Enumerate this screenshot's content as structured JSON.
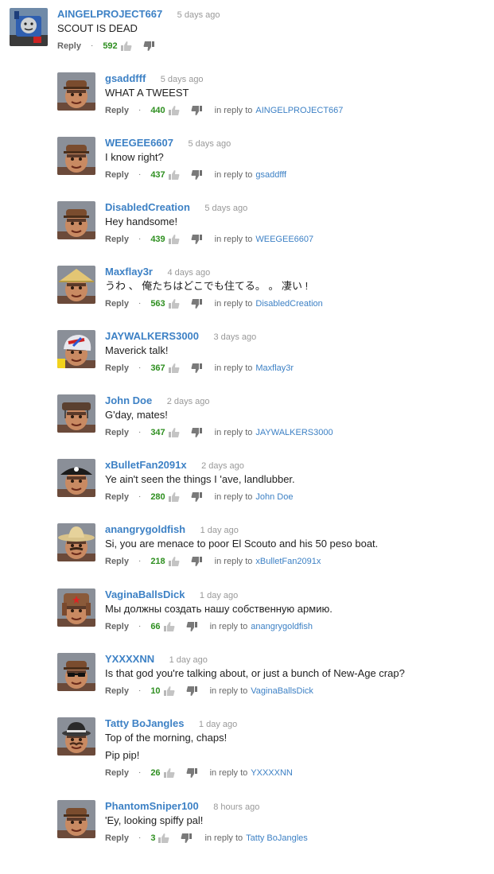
{
  "colors": {
    "author": "#3d81c5",
    "likes": "#2e8f20",
    "timestamp": "#999999",
    "meta": "#666666"
  },
  "labels": {
    "reply": "Reply",
    "in_reply_to": "in reply to"
  },
  "comments": [
    {
      "author": "AINGELPROJECT667",
      "time": "5 days ago",
      "text": [
        "SCOUT IS DEAD"
      ],
      "likes": "592",
      "in_reply_to": "",
      "avatar_icon": "thomas-engine-avatar-icon"
    },
    {
      "author": "gsaddfff",
      "time": "5 days ago",
      "text": [
        "WHAT A TWEEST"
      ],
      "likes": "440",
      "in_reply_to": "AINGELPROJECT667",
      "avatar_icon": "scout-avatar-icon"
    },
    {
      "author": "WEEGEE6607",
      "time": "5 days ago",
      "text": [
        "I know right?"
      ],
      "likes": "437",
      "in_reply_to": "gsaddfff",
      "avatar_icon": "scout-avatar-icon"
    },
    {
      "author": "DisabledCreation",
      "time": "5 days ago",
      "text": [
        "Hey handsome!"
      ],
      "likes": "439",
      "in_reply_to": "WEEGEE6607",
      "avatar_icon": "scout-avatar-icon"
    },
    {
      "author": "Maxflay3r",
      "time": "4 days ago",
      "text": [
        "うわ 、 俺たちはどこでも住てる。 。 凄い !"
      ],
      "likes": "563",
      "in_reply_to": "DisabledCreation",
      "avatar_icon": "straw-hat-scout-avatar-icon"
    },
    {
      "author": "JAYWALKERS3000",
      "time": "3 days ago",
      "text": [
        "Maverick talk!"
      ],
      "likes": "367",
      "in_reply_to": "Maxflay3r",
      "avatar_icon": "helmet-scout-avatar-icon"
    },
    {
      "author": "John Doe",
      "time": "2 days ago",
      "text": [
        "G'day, mates!"
      ],
      "likes": "347",
      "in_reply_to": "JAYWALKERS3000",
      "avatar_icon": "cork-hat-scout-avatar-icon"
    },
    {
      "author": "xBulletFan2091x",
      "time": "2 days ago",
      "text": [
        "Ye ain't seen the things I 'ave, landlubber."
      ],
      "likes": "280",
      "in_reply_to": "John Doe",
      "avatar_icon": "pirate-scout-avatar-icon"
    },
    {
      "author": "anangrygoldfish",
      "time": "1 day ago",
      "text": [
        "Si, you are menace to poor El Scouto and his 50 peso boat."
      ],
      "likes": "218",
      "in_reply_to": "xBulletFan2091x",
      "avatar_icon": "sombrero-scout-avatar-icon"
    },
    {
      "author": "VaginaBallsDick",
      "time": "1 day ago",
      "text": [
        "Мы должны создать нашу собственную армию."
      ],
      "likes": "66",
      "in_reply_to": "anangrygoldfish",
      "avatar_icon": "ushanka-scout-avatar-icon"
    },
    {
      "author": "YXXXXNN",
      "time": "1 day ago",
      "text": [
        "Is that god you're talking about, or just a bunch of New-Age crap?"
      ],
      "likes": "10",
      "in_reply_to": "VaginaBallsDick",
      "avatar_icon": "sunglasses-scout-avatar-icon"
    },
    {
      "author": "Tatty BoJangles",
      "time": "1 day ago",
      "text": [
        "Top of the morning, chaps!",
        "Pip pip!"
      ],
      "likes": "26",
      "in_reply_to": "YXXXXNN",
      "avatar_icon": "bowler-hat-scout-avatar-icon"
    },
    {
      "author": "PhantomSniper100",
      "time": "8 hours ago",
      "text": [
        "'Ey, looking spiffy pal!"
      ],
      "likes": "3",
      "in_reply_to": "Tatty BoJangles",
      "avatar_icon": "scout-avatar-icon"
    }
  ]
}
